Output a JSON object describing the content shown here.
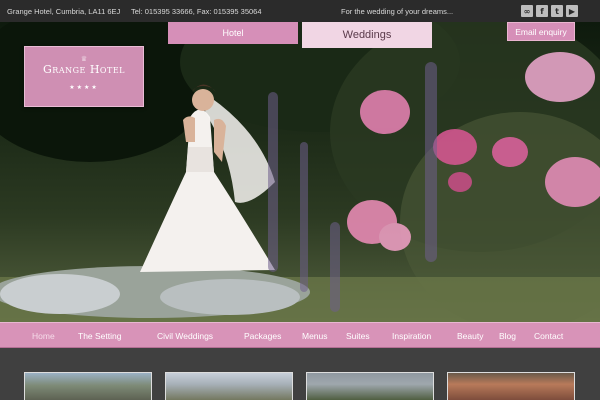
{
  "topbar": {
    "address": "Grange Hotel, Cumbria, LA11 6EJ",
    "phone": "Tel: 015395 33666, Fax: 015395 35064",
    "tagline": "For the wedding of your dreams..."
  },
  "social": [
    {
      "icon": "tripadvisor-icon",
      "glyph": "∞"
    },
    {
      "icon": "facebook-icon",
      "glyph": "f"
    },
    {
      "icon": "twitter-icon",
      "glyph": "t"
    },
    {
      "icon": "youtube-icon",
      "glyph": "▶"
    }
  ],
  "logo": {
    "name": "Grange Hotel",
    "stars": "★★★★",
    "crown": "♕"
  },
  "header_tabs": {
    "hotel": "Hotel",
    "weddings": "Weddings",
    "enquiry": "Email enquiry"
  },
  "nav": [
    {
      "label": "Home",
      "active": true
    },
    {
      "label": "The Setting"
    },
    {
      "label": "Civil Weddings"
    },
    {
      "label": "Packages"
    },
    {
      "label": "Menus"
    },
    {
      "label": "Suites"
    },
    {
      "label": "Inspiration"
    },
    {
      "label": "Beauty"
    },
    {
      "label": "Blog"
    },
    {
      "label": "Contact"
    }
  ],
  "colors": {
    "accent_pink": "#d893b8",
    "light_pink": "#f1d6e4",
    "dark_bar": "#2b2b2b"
  }
}
